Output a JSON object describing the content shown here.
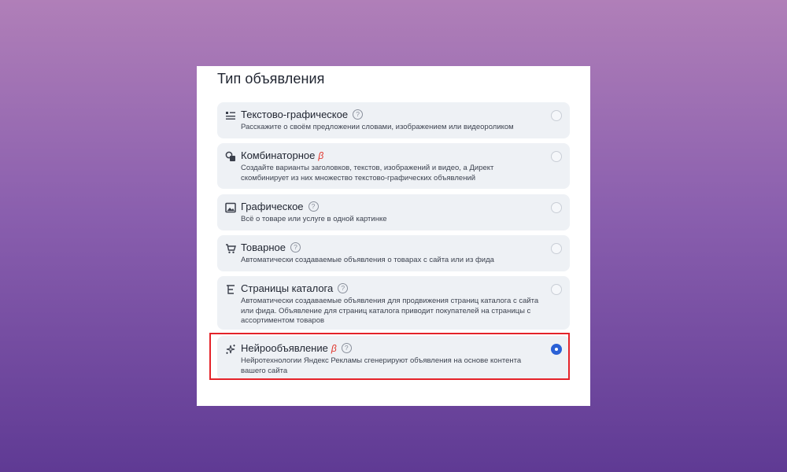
{
  "panel": {
    "title": "Тип объявления"
  },
  "options": [
    {
      "icon": "text-graphic-icon",
      "title": "Текстово-графическое",
      "beta": "",
      "help": "?",
      "description": "Расскажите о своём предложении словами, изображением или видеороликом",
      "selected": false
    },
    {
      "icon": "combinatorial-icon",
      "title": "Комбинаторное",
      "beta": "β",
      "help": "",
      "description": "Создайте варианты заголовков, текстов, изображений и видео, а Директ скомбинирует из них множество текстово-графических объявлений",
      "selected": false
    },
    {
      "icon": "image-icon",
      "title": "Графическое",
      "beta": "",
      "help": "?",
      "description": "Всё о товаре или услуге в одной картинке",
      "selected": false
    },
    {
      "icon": "cart-icon",
      "title": "Товарное",
      "beta": "",
      "help": "?",
      "description": "Автоматически создаваемые объявления о товарах с сайта или из фида",
      "selected": false
    },
    {
      "icon": "catalog-icon",
      "title": "Страницы каталога",
      "beta": "",
      "help": "?",
      "description": "Автоматически создаваемые объявления для продвижения страниц каталога с сайта или фида. Объявление для страниц каталога приводит покупателей на страницы с ассортиментом товаров",
      "selected": false
    },
    {
      "icon": "sparkles-icon",
      "title": "Нейрообъявление",
      "beta": "β",
      "help": "?",
      "description": "Нейротехнологии Яндекс Рекламы сгенерируют объявления на основе контента вашего сайта",
      "selected": true
    }
  ],
  "colors": {
    "accent": "#2b61d6",
    "beta": "#e0342b",
    "highlight": "#e4232a",
    "card": "#eef1f5"
  }
}
